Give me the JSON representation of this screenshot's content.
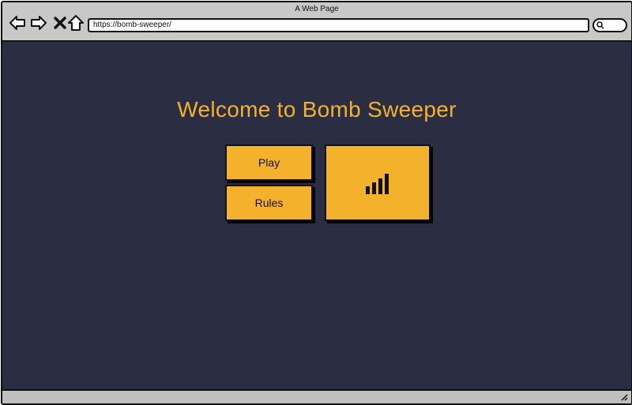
{
  "window": {
    "title": "A Web Page"
  },
  "toolbar": {
    "icons": [
      "back-arrow-icon",
      "forward-arrow-icon",
      "close-x-icon",
      "home-icon"
    ],
    "url": "https://bomb-sweeper/",
    "search_icon": "search-icon"
  },
  "page": {
    "heading": "Welcome to Bomb Sweeper",
    "play_label": "Play",
    "rules_label": "Rules",
    "stats_icon": "bar-chart-icon"
  },
  "colors": {
    "content_bg": "#2b2d43",
    "accent": "#f4b12c",
    "chrome_bg": "#c8c8c8"
  }
}
